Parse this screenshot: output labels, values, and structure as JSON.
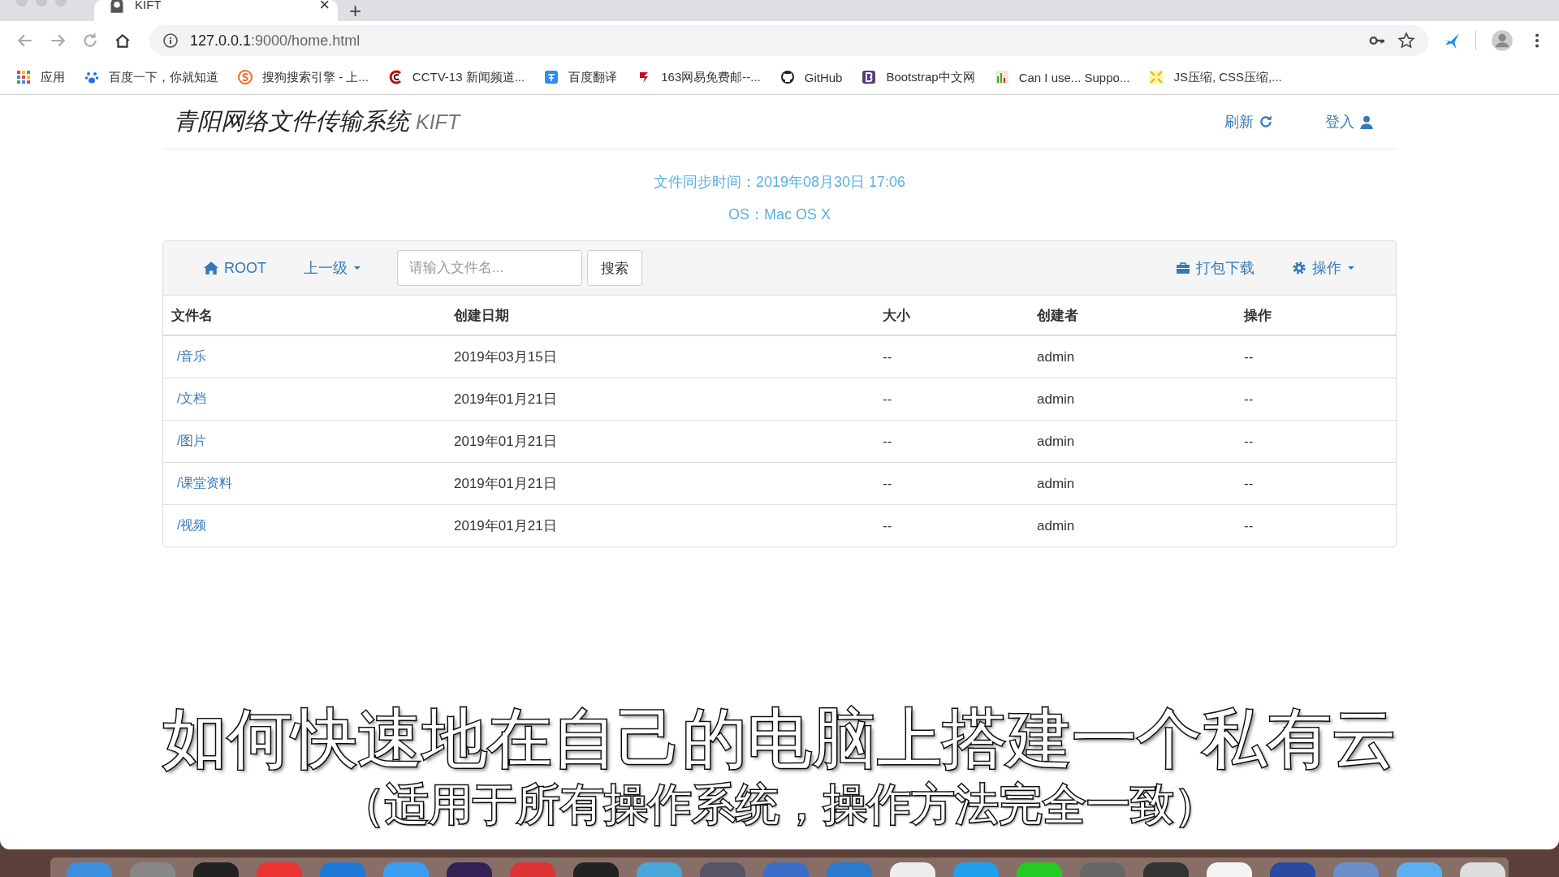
{
  "browser": {
    "tab": {
      "title": "KIFT",
      "close": "×"
    },
    "new_tab": "+",
    "address": {
      "host": "127.0.0.1",
      "rest": ":9000/home.html"
    },
    "bookmarks": [
      {
        "label": "应用",
        "kind": "apps"
      },
      {
        "label": "百度一下，你就知道",
        "kind": "paw"
      },
      {
        "label": "搜狗搜索引擎 - 上...",
        "kind": "sogou"
      },
      {
        "label": "CCTV-13 新闻频道...",
        "kind": "cctv"
      },
      {
        "label": "百度翻译",
        "kind": "translate"
      },
      {
        "label": "163网易免费邮--...",
        "kind": "mail"
      },
      {
        "label": "GitHub",
        "kind": "github"
      },
      {
        "label": "Bootstrap中文网",
        "kind": "bootstrap"
      },
      {
        "label": "Can I use... Suppo...",
        "kind": "chart"
      },
      {
        "label": "JS压缩, CSS压缩,...",
        "kind": "compress"
      }
    ]
  },
  "header": {
    "title": "青阳网络文件传输系统",
    "brand": "KIFT",
    "refresh": "刷新",
    "login": "登入"
  },
  "info": {
    "sync": "文件同步时间：2019年08月30日 17:06",
    "os": "OS：Mac OS X"
  },
  "toolbar": {
    "root": "ROOT",
    "up": "上一级",
    "search": {
      "placeholder": "请输入文件名..."
    },
    "search_button": "搜索",
    "pack": "打包下载",
    "actions": "操作"
  },
  "table": {
    "columns": [
      "文件名",
      "创建日期",
      "大小",
      "创建者",
      "操作"
    ],
    "rows": [
      [
        "/音乐",
        "2019年03月15日",
        "--",
        "admin",
        "--"
      ],
      [
        "/文档",
        "2019年01月21日",
        "--",
        "admin",
        "--"
      ],
      [
        "/图片",
        "2019年01月21日",
        "--",
        "admin",
        "--"
      ],
      [
        "/课堂资料",
        "2019年01月21日",
        "--",
        "admin",
        "--"
      ],
      [
        "/视频",
        "2019年01月21日",
        "--",
        "admin",
        "--"
      ]
    ]
  },
  "caption": {
    "title": "如何快速地在自己的电脑上搭建一个私有云",
    "subtitle": "（适用于所有操作系统，操作方法完全一致）"
  }
}
